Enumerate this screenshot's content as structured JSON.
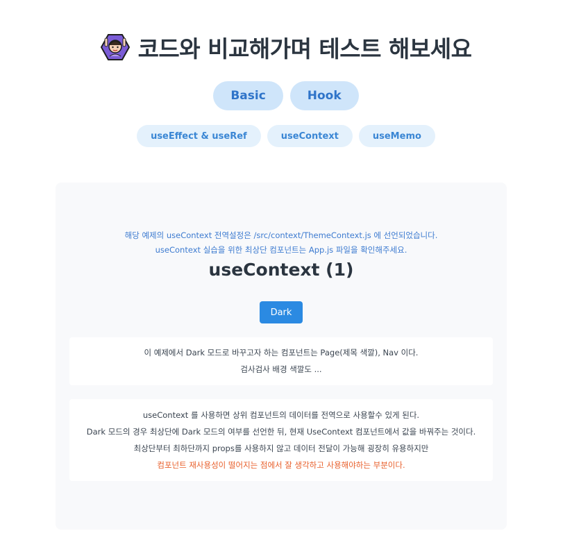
{
  "header": {
    "emoji_icon": "raising-hand-person-icon",
    "title": "코드와 비교해가며 테스트 해보세요"
  },
  "main_tabs": [
    {
      "label": "Basic"
    },
    {
      "label": "Hook"
    }
  ],
  "sub_tabs": [
    {
      "label": "useEffect & useRef"
    },
    {
      "label": "useContext"
    },
    {
      "label": "useMemo"
    }
  ],
  "panel": {
    "notice_lines": [
      "해당 예제의 useContext 전역설정은 /src/context/ThemeContext.js 에 선언되었습니다.",
      "useContext 실습을 위한 최상단 컴포넌트는 App.js 파일을 확인해주세요."
    ],
    "title": "useContext (1)",
    "dark_button_label": "Dark",
    "card1_lines": [
      "이 예제에서 Dark 모드로 바꾸고자 하는 컴포넌트는 Page(제목 색깔), Nav 이다.",
      "검사검사 배경 색깔도 ..."
    ],
    "card2_lines": [
      "useContext 를 사용하면 상위 컴포넌트의 데이터를 전역으로 사용할수 있게 된다.",
      "Dark 모드의 경우 최상단에 Dark 모드의 여부를 선언한 뒤, 현재 UseContext 컴포넌트에서 값을 바꿔주는 것이다.",
      "최상단부터 최하단까지 props를 사용하지 않고 데이터 전달이 가능해 굉장히 유용하지만"
    ],
    "card2_warning": "컴포넌트 재사용성이 떨어지는 점에서 잘 생각하고 사용해야하는 부분이다."
  },
  "colors": {
    "tab_bg": "#cfe5fa",
    "tab_text": "#2f74c9",
    "subtab_bg": "#e4f1fc",
    "notice_text": "#3d7bd0",
    "button_bg": "#2b8ae2",
    "warning_text": "#e8602c",
    "panel_bg": "#f8f9fb"
  }
}
